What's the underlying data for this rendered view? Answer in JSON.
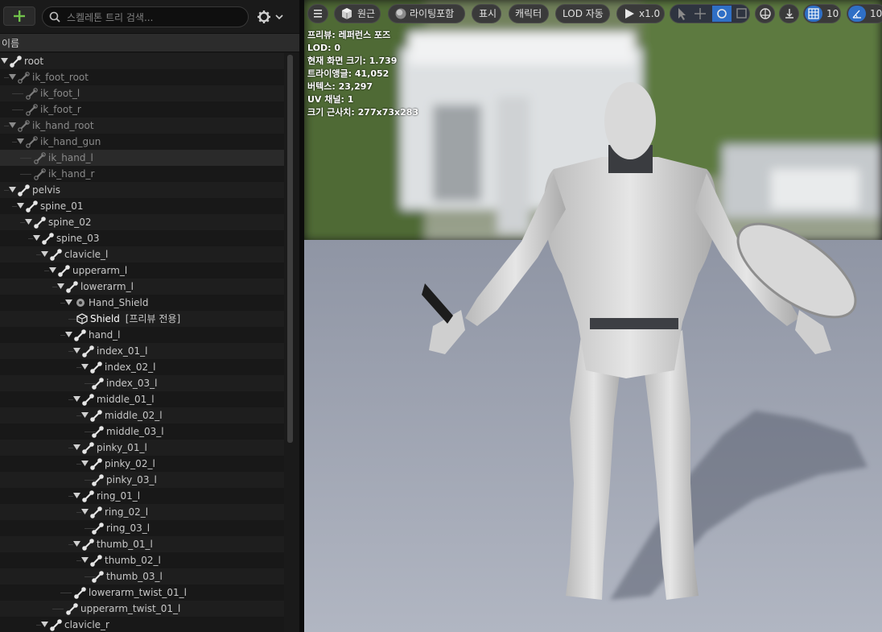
{
  "panel": {
    "search_placeholder": "스켈레톤 트리 검색...",
    "column_header": "이름"
  },
  "tree_rows": [
    {
      "label": "root",
      "level": 0,
      "kind": "bone",
      "arrow": true,
      "dim": false
    },
    {
      "label": "ik_foot_root",
      "level": 1,
      "kind": "bone",
      "arrow": true,
      "dim": true
    },
    {
      "label": "ik_foot_l",
      "level": 2,
      "kind": "bone",
      "arrow": false,
      "dim": true
    },
    {
      "label": "ik_foot_r",
      "level": 2,
      "kind": "bone",
      "arrow": false,
      "dim": true
    },
    {
      "label": "ik_hand_root",
      "level": 1,
      "kind": "bone",
      "arrow": true,
      "dim": true
    },
    {
      "label": "ik_hand_gun",
      "level": 2,
      "kind": "bone",
      "arrow": true,
      "dim": true
    },
    {
      "label": "ik_hand_l",
      "level": 3,
      "kind": "bone",
      "arrow": false,
      "dim": true,
      "selected": true
    },
    {
      "label": "ik_hand_r",
      "level": 3,
      "kind": "bone",
      "arrow": false,
      "dim": true
    },
    {
      "label": "pelvis",
      "level": 1,
      "kind": "bone",
      "arrow": true,
      "dim": false
    },
    {
      "label": "spine_01",
      "level": 2,
      "kind": "bone",
      "arrow": true,
      "dim": false
    },
    {
      "label": "spine_02",
      "level": 3,
      "kind": "bone",
      "arrow": true,
      "dim": false
    },
    {
      "label": "spine_03",
      "level": 4,
      "kind": "bone",
      "arrow": true,
      "dim": false
    },
    {
      "label": "clavicle_l",
      "level": 5,
      "kind": "bone",
      "arrow": true,
      "dim": false
    },
    {
      "label": "upperarm_l",
      "level": 6,
      "kind": "bone",
      "arrow": true,
      "dim": false
    },
    {
      "label": "lowerarm_l",
      "level": 7,
      "kind": "bone",
      "arrow": true,
      "dim": false
    },
    {
      "label": "Hand_Shield",
      "level": 8,
      "kind": "socket",
      "arrow": true,
      "dim": false
    },
    {
      "label": "Shield",
      "suffix": " [프리뷰 전용]",
      "level": 9,
      "kind": "mesh",
      "arrow": false,
      "dim": false,
      "bright": true
    },
    {
      "label": "hand_l",
      "level": 8,
      "kind": "bone",
      "arrow": true,
      "dim": false
    },
    {
      "label": "index_01_l",
      "level": 9,
      "kind": "bone",
      "arrow": true,
      "dim": false
    },
    {
      "label": "index_02_l",
      "level": 10,
      "kind": "bone",
      "arrow": true,
      "dim": false
    },
    {
      "label": "index_03_l",
      "level": 11,
      "kind": "bone",
      "arrow": false,
      "dim": false
    },
    {
      "label": "middle_01_l",
      "level": 9,
      "kind": "bone",
      "arrow": true,
      "dim": false
    },
    {
      "label": "middle_02_l",
      "level": 10,
      "kind": "bone",
      "arrow": true,
      "dim": false
    },
    {
      "label": "middle_03_l",
      "level": 11,
      "kind": "bone",
      "arrow": false,
      "dim": false
    },
    {
      "label": "pinky_01_l",
      "level": 9,
      "kind": "bone",
      "arrow": true,
      "dim": false
    },
    {
      "label": "pinky_02_l",
      "level": 10,
      "kind": "bone",
      "arrow": true,
      "dim": false
    },
    {
      "label": "pinky_03_l",
      "level": 11,
      "kind": "bone",
      "arrow": false,
      "dim": false
    },
    {
      "label": "ring_01_l",
      "level": 9,
      "kind": "bone",
      "arrow": true,
      "dim": false
    },
    {
      "label": "ring_02_l",
      "level": 10,
      "kind": "bone",
      "arrow": true,
      "dim": false
    },
    {
      "label": "ring_03_l",
      "level": 11,
      "kind": "bone",
      "arrow": false,
      "dim": false
    },
    {
      "label": "thumb_01_l",
      "level": 9,
      "kind": "bone",
      "arrow": true,
      "dim": false
    },
    {
      "label": "thumb_02_l",
      "level": 10,
      "kind": "bone",
      "arrow": true,
      "dim": false
    },
    {
      "label": "thumb_03_l",
      "level": 11,
      "kind": "bone",
      "arrow": false,
      "dim": false
    },
    {
      "label": "lowerarm_twist_01_l",
      "level": 8,
      "kind": "bone",
      "arrow": false,
      "dim": false
    },
    {
      "label": "upperarm_twist_01_l",
      "level": 7,
      "kind": "bone",
      "arrow": false,
      "dim": false
    },
    {
      "label": "clavicle_r",
      "level": 5,
      "kind": "bone",
      "arrow": true,
      "dim": false
    }
  ],
  "viewport": {
    "toolbar": {
      "perspective": "원근",
      "lighting": "라이팅포함",
      "show": "표시",
      "character": "캐릭터",
      "lod": "LOD 자동",
      "speed": "x1.0",
      "grid_snap": "10",
      "rotation_snap": "10"
    },
    "info": {
      "preview": "프리뷰: 레퍼런스 포즈",
      "lod": "LOD: 0",
      "screen_size": "현재 화면 크기: 1.739",
      "triangles": "트라이앵글: 41,052",
      "vertices": "버텍스: 23,297",
      "uv_channels": "UV 채널: 1",
      "approx_size": "크기 근사치: 277x73x283"
    }
  },
  "colors": {
    "accent_green": "#71c24b",
    "accent_blue": "#2f6fc6",
    "text_normal": "#c8c8c8",
    "text_dim": "#8a8a8a"
  }
}
